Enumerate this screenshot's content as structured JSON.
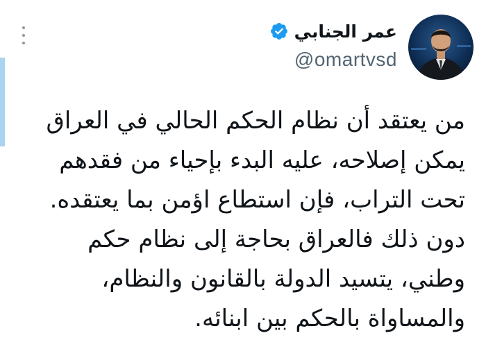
{
  "tweet": {
    "author": {
      "display_name": "عمر الجنابي",
      "handle": "@omartvsd",
      "verified": true,
      "verified_icon": "verified-badge-icon",
      "avatar_icon": "profile-photo"
    },
    "more_icon": "more-options-icon",
    "lines": [
      "من يعتقد أن نظام الحكم الحالي في العراق",
      "يمكن إصلاحه، عليه البدء بإحياء من فقدهم",
      "تحت التراب، فإن استطاع اؤمن بما يعتقده.",
      "دون ذلك فالعراق بحاجة إلى نظام حكم",
      "وطني، يتسيد الدولة بالقانون والنظام،",
      "والمساواة بالحكم بين ابنائه."
    ]
  },
  "colors": {
    "text": "#0f1419",
    "secondary_text": "#536471",
    "verified_blue": "#1d9bf0",
    "accent_bar": "#a9d3ee"
  }
}
